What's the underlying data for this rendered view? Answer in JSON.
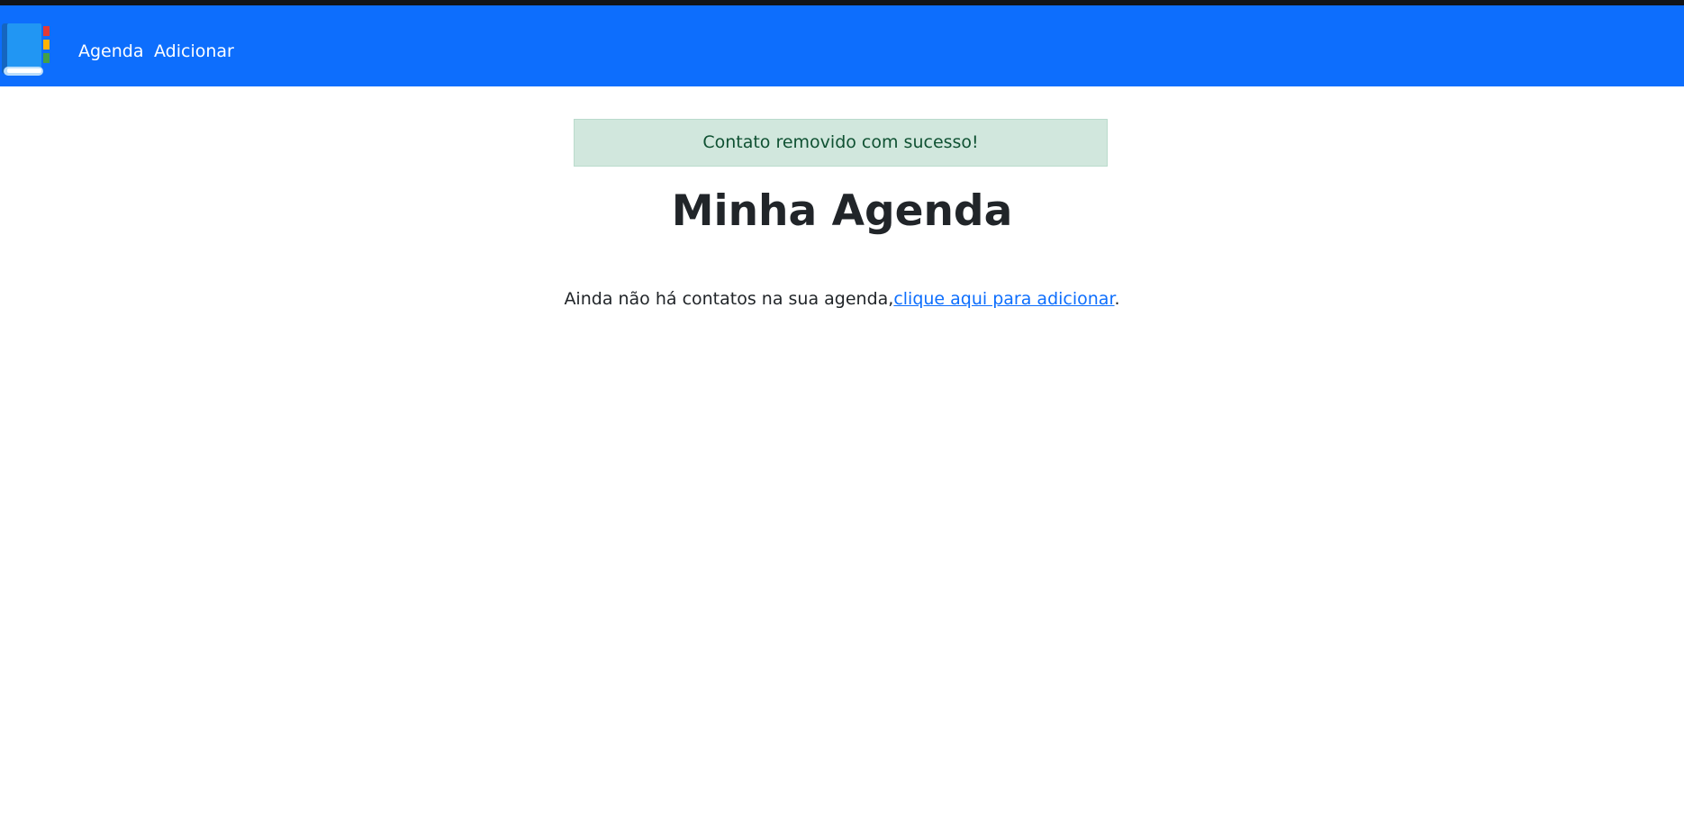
{
  "navbar": {
    "logo_icon": "address-book-icon",
    "links": [
      {
        "label": "Agenda"
      },
      {
        "label": "Adicionar"
      }
    ],
    "bg_color": "#0d6efd"
  },
  "alert": {
    "message": "Contato removido com sucesso!",
    "type": "success"
  },
  "main": {
    "title": "Minha Agenda",
    "empty_prefix": "Ainda não há contatos na sua agenda,",
    "empty_link": "clique aqui para adicionar",
    "empty_suffix": "."
  }
}
